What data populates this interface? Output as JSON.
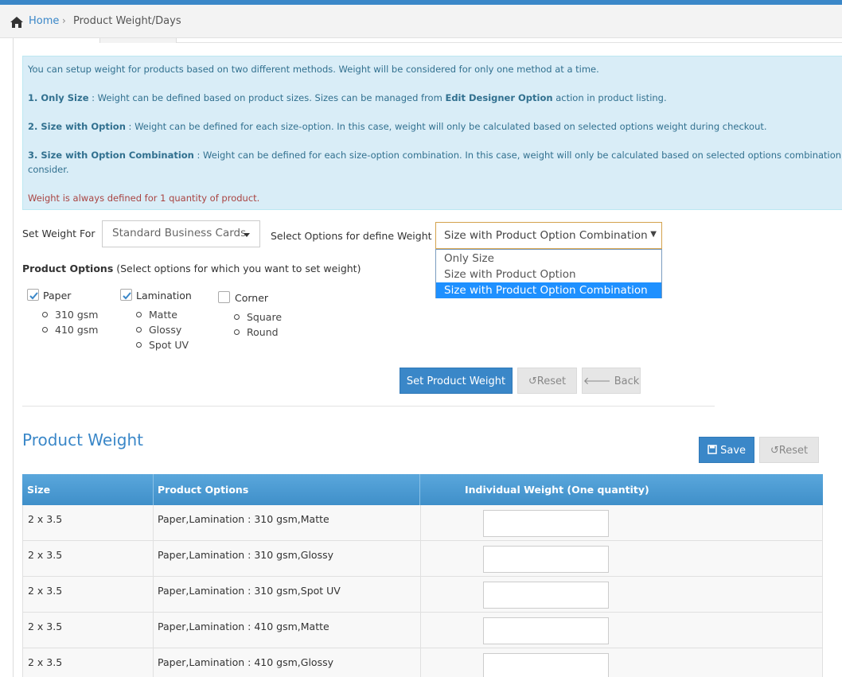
{
  "breadcrumb": {
    "home": "Home",
    "separator": "›",
    "current": "Product Weight/Days"
  },
  "info": {
    "intro": "You can setup weight for products based on two different methods. Weight will be considered for only one method at a time.",
    "item1_title": "1. Only Size",
    "item1_text_a": " : Weight can be defined based on product sizes. Sizes can be managed from ",
    "item1_link": "Edit Designer Option",
    "item1_text_b": " action in product listing.",
    "item2_title": "2. Size with Option",
    "item2_text": " : Weight can be defined for each size-option. In this case, weight will only be calculated based on selected options weight during checkout.",
    "item3_title": "3. Size with Option Combination",
    "item3_text": " : Weight can be defined for each size-option combination. In this case, weight will only be calculated based on selected options combination weight dur",
    "item3_cont": "consider.",
    "warning": "Weight is always defined for 1 quantity of product."
  },
  "form": {
    "set_weight_for_label": "Set Weight For",
    "product_value": "Standard Business Cards",
    "select_options_label": "Select Options for define Weight",
    "method_value": "Size with Product Option Combination",
    "method_options": [
      "Only Size",
      "Size with Product Option",
      "Size with Product Option Combination"
    ],
    "product_options_label": "Product Options",
    "product_options_hint": " (Select options for which you want to set weight)"
  },
  "option_groups": [
    {
      "name": "Paper",
      "checked": true,
      "values": [
        "310 gsm",
        "410 gsm"
      ]
    },
    {
      "name": "Lamination",
      "checked": true,
      "values": [
        "Matte",
        "Glossy",
        "Spot UV"
      ]
    },
    {
      "name": "Corner",
      "checked": false,
      "values": [
        "Square",
        "Round"
      ]
    }
  ],
  "buttons": {
    "set_weight": "Set Product Weight",
    "reset": "Reset",
    "back": "Back",
    "save": "Save",
    "reset2": "Reset"
  },
  "section_title": "Product Weight",
  "table": {
    "headers": [
      "Size",
      "Product Options",
      "Individual Weight (One quantity)"
    ],
    "rows": [
      {
        "size": "2 x 3.5",
        "options": "Paper,Lamination : 310 gsm,Matte",
        "weight": ""
      },
      {
        "size": "2 x 3.5",
        "options": "Paper,Lamination : 310 gsm,Glossy",
        "weight": ""
      },
      {
        "size": "2 x 3.5",
        "options": "Paper,Lamination : 310 gsm,Spot UV",
        "weight": ""
      },
      {
        "size": "2 x 3.5",
        "options": "Paper,Lamination : 410 gsm,Matte",
        "weight": ""
      },
      {
        "size": "2 x 3.5",
        "options": "Paper,Lamination : 410 gsm,Glossy",
        "weight": ""
      }
    ]
  },
  "colors": {
    "accent": "#3a87c8",
    "info_bg": "#d9edf7",
    "info_text": "#31708f",
    "warning": "#a94442",
    "selected_option": "#1e90ff"
  },
  "icons": {
    "home": "home-icon",
    "reset": "undo-icon",
    "back": "arrow-left-icon",
    "save": "floppy-disk-icon"
  }
}
